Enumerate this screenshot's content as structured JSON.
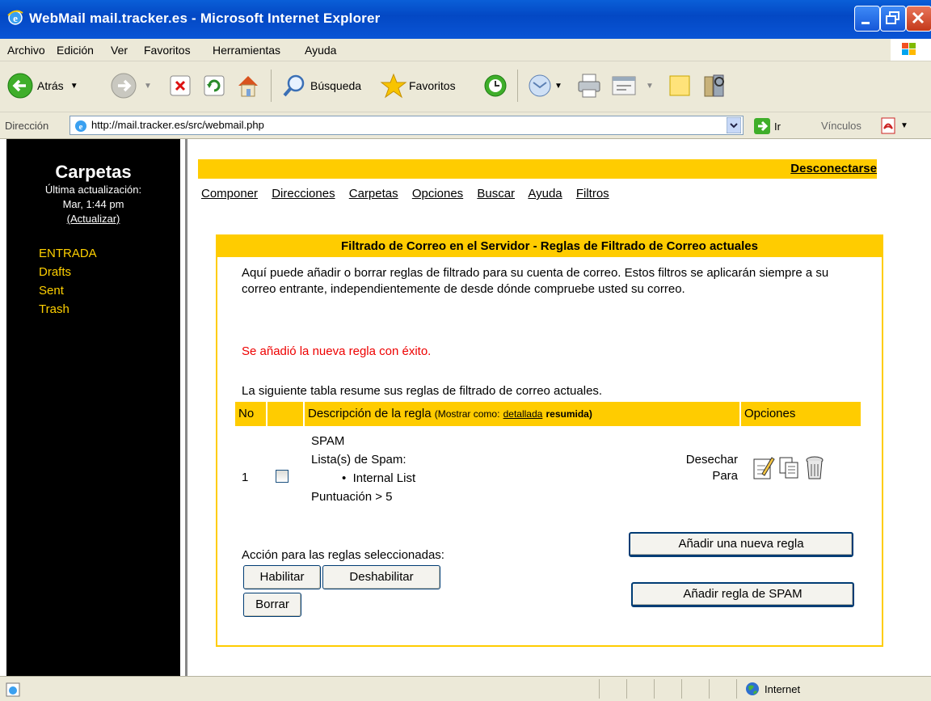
{
  "window": {
    "title": "WebMail mail.tracker.es - Microsoft Internet Explorer"
  },
  "menu": [
    "Archivo",
    "Edición",
    "Ver",
    "Favoritos",
    "Herramientas",
    "Ayuda"
  ],
  "toolbar": {
    "back_label": "Atrás",
    "search_label": "Búsqueda",
    "favorites_label": "Favoritos"
  },
  "address": {
    "label": "Dirección",
    "url": "http://mail.tracker.es/src/webmail.php",
    "go_label": "Ir",
    "links_label": "Vínculos"
  },
  "sidebar": {
    "heading": "Carpetas",
    "last_update_label": "Última actualización:",
    "last_update_time": "Mar, 1:44 pm",
    "refresh_link": "(Actualizar)",
    "folders": [
      "ENTRADA",
      "Drafts",
      "Sent",
      "Trash"
    ]
  },
  "topbar": {
    "logout": "Desconectarse"
  },
  "nav": [
    "Componer",
    "Direcciones",
    "Carpetas",
    "Opciones",
    "Buscar",
    "Ayuda",
    "Filtros"
  ],
  "panel": {
    "title": "Filtrado de Correo en el Servidor - Reglas de Filtrado de Correo actuales",
    "intro": "Aquí puede añadir o borrar reglas de filtrado para su cuenta de correo. Estos filtros se aplicarán siempre a su correo entrante, independientemente de desde dónde compruebe usted su correo.",
    "success": "Se añadió la nueva regla con éxito.",
    "summary": "La siguiente tabla resume sus reglas de filtrado de correo actuales.",
    "table": {
      "col_no": "No",
      "col_desc": "Descripción de la regla",
      "show_as": "(Mostrar como:",
      "detailed": "detallada",
      "summarized": "resumida)",
      "col_options": "Opciones"
    },
    "rule": {
      "number": "1",
      "name": "SPAM",
      "lists_label": "Lista(s) de Spam:",
      "list_item": "Internal List",
      "score": "Puntuación > 5",
      "action_line1": "Desechar",
      "action_line2": "Para"
    },
    "selected_action_label": "Acción para las reglas seleccionadas:",
    "buttons": {
      "enable": "Habilitar",
      "disable": "Deshabilitar",
      "delete": "Borrar",
      "add_rule": "Añadir una nueva regla",
      "add_spam": "Añadir regla de SPAM"
    }
  },
  "status": {
    "zone": "Internet"
  }
}
